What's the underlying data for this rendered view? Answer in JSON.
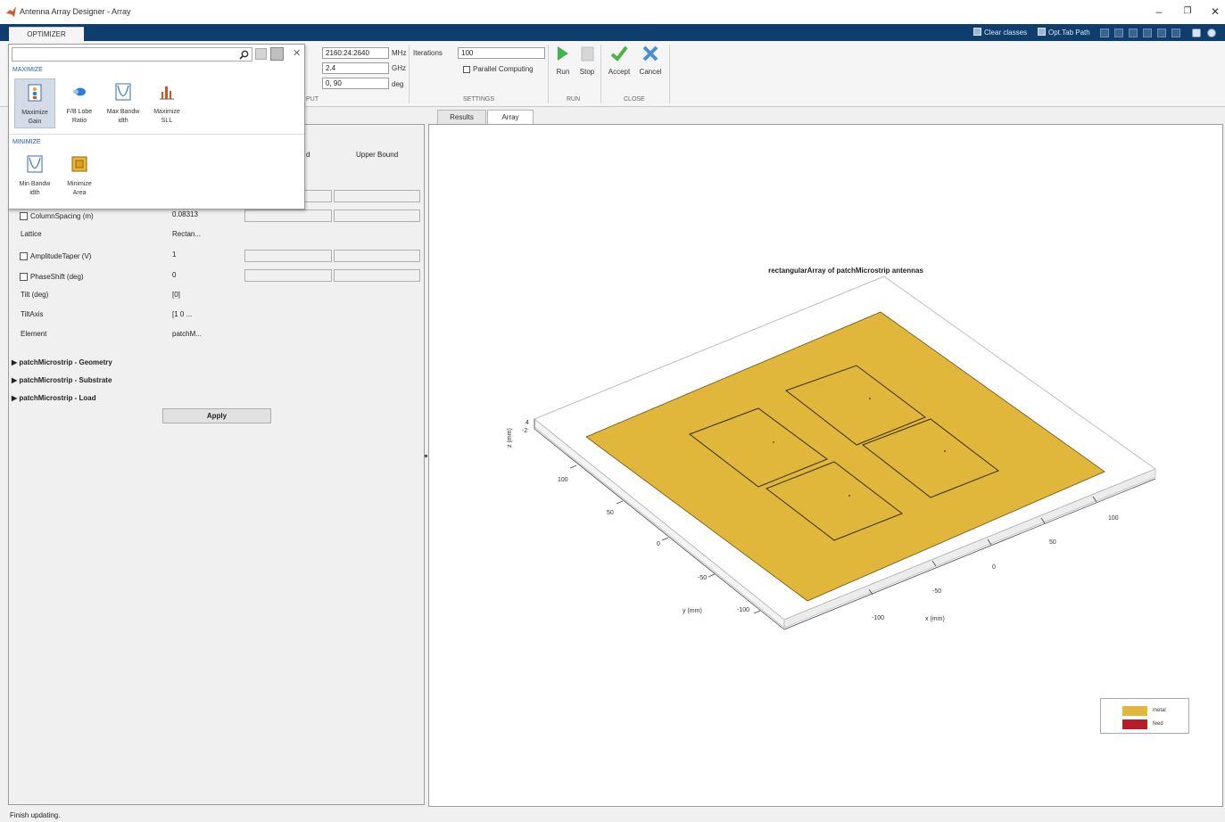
{
  "window": {
    "title": "Antenna Array Designer - Array",
    "controls": [
      "–",
      "❐",
      "✕"
    ]
  },
  "ribbon_tabs": [
    "OPTIMIZER"
  ],
  "quick_access": {
    "clear_classes": "Clear classes",
    "opt_tab_path": "Opt.Tab Path"
  },
  "ribbon": {
    "input": {
      "section": "PUT",
      "frequency_value": "2160:24:2640",
      "frequency_unit": "MHz",
      "center_value": "2.4",
      "center_unit": "GHz",
      "direction_value": "0, 90",
      "direction_unit": "deg"
    },
    "settings": {
      "section": "SETTINGS",
      "iterations_label": "Iterations",
      "iterations_value": "100",
      "parallel_label": "Parallel Computing"
    },
    "run": {
      "section": "RUN",
      "run_label": "Run",
      "stop_label": "Stop"
    },
    "close": {
      "section": "CLOSE",
      "accept_label": "Accept",
      "cancel_label": "Cancel"
    }
  },
  "gallery": {
    "maximize_header": "MAXIMIZE",
    "minimize_header": "MINIMIZE",
    "maximize_items": [
      {
        "line1": "Maximize",
        "line2": "Gain"
      },
      {
        "line1": "F/B Lobe",
        "line2": "Ratio"
      },
      {
        "line1": "Max Bandw",
        "line2": "idth"
      },
      {
        "line1": "Maximize",
        "line2": "SLL"
      }
    ],
    "minimize_items": [
      {
        "line1": "Min Bandw",
        "line2": "idth"
      },
      {
        "line1": "Minimize",
        "line2": "Area"
      }
    ]
  },
  "properties": {
    "lower_bound_fragment": "d",
    "upper_bound_header": "Upper Bound",
    "rows": [
      {
        "label": "ColumnSpacing (m)",
        "value": "0.08313",
        "checkbox": true
      },
      {
        "label": "Lattice",
        "value": "Rectan...",
        "checkbox": false
      },
      {
        "label": "AmplitudeTaper (V)",
        "value": "1",
        "checkbox": true
      },
      {
        "label": "PhaseShift (deg)",
        "value": "0",
        "checkbox": true
      },
      {
        "label": "Tilt (deg)",
        "value": "[0]",
        "checkbox": false
      },
      {
        "label": "TiltAxis",
        "value": "[1 0 ...",
        "checkbox": false
      },
      {
        "label": "Element",
        "value": "patchM...",
        "checkbox": false
      }
    ],
    "sections": [
      "patchMicrostrip - Geometry",
      "patchMicrostrip - Substrate",
      "patchMicrostrip - Load"
    ],
    "apply_label": "Apply"
  },
  "doc_tabs": [
    "Results",
    "Array"
  ],
  "plot": {
    "title": "rectangularArray of patchMicrostrip antennas",
    "z_label": "z (mm)",
    "z_ticks": [
      "4",
      "-2"
    ],
    "y_label": "y (mm)",
    "y_ticks": [
      "100",
      "50",
      "0",
      "-50",
      "-100"
    ],
    "x_label": "x (mm)",
    "x_ticks": [
      "100",
      "50",
      "0",
      "-50",
      "-100"
    ],
    "legend": [
      {
        "name": "metal",
        "color": "#e0b73a"
      },
      {
        "name": "feed",
        "color": "#b81d2c"
      }
    ]
  },
  "status_text": "Finish updating."
}
